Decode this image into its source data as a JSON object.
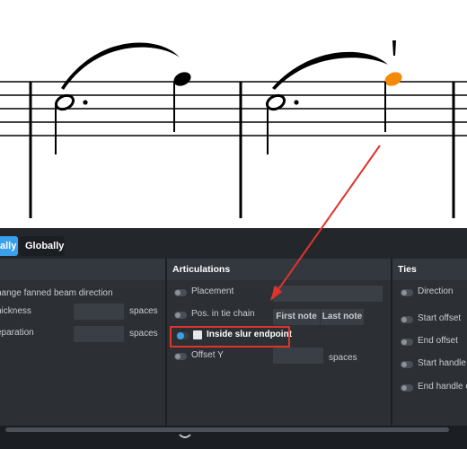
{
  "tabs": {
    "locally": "ally",
    "globally": "Globally"
  },
  "groups": {
    "left": {
      "rows": {
        "fanned": "hange fanned beam direction",
        "thickness": "hickness",
        "separation": "eparation",
        "spaces1": "spaces",
        "spaces2": "spaces"
      }
    },
    "articulations": {
      "title": "Articulations",
      "placement": "Placement",
      "pos_in_tie_chain": "Pos. in tie chain",
      "first_note": "First note",
      "last_note": "Last note",
      "inside_slur_endpoint": "Inside slur endpoint",
      "offset_y": "Offset Y",
      "spaces": "spaces"
    },
    "ties": {
      "title": "Ties",
      "direction": "Direction",
      "start_offset": "Start offset",
      "end_offset": "End offset",
      "start_handle": "Start handle o",
      "end_handle": "End handle o"
    }
  },
  "colors": {
    "accent": "#3ba0ea",
    "selected_note": "#f5890a",
    "annotation": "#e0332c"
  },
  "icons": {
    "collapse": "chevron-down-icon"
  }
}
